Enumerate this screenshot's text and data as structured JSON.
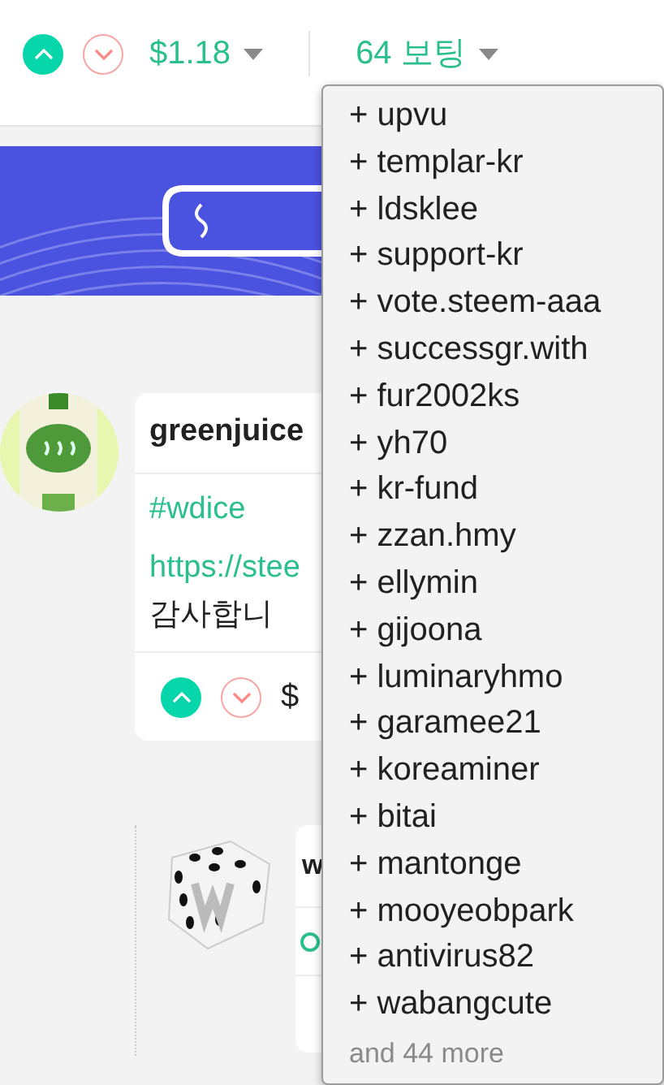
{
  "header": {
    "upvote": {
      "voted": true
    },
    "downvote": {
      "voted": false
    },
    "payout": "$1.18",
    "votes": "64 보팅"
  },
  "voters_dropdown": {
    "voters": [
      "+ upvu",
      "+ templar-kr",
      "+ ldsklee",
      "+ support-kr",
      "+ vote.steem-aaa",
      "+ successgr.with",
      "+ fur2002ks",
      "+ yh70",
      "+ kr-fund",
      "+ zzan.hmy",
      "+ ellymin",
      "+ gijoona",
      "+ luminaryhmo",
      "+ garamee21",
      "+ koreaminer",
      "+ bitai",
      "+ mantonge",
      "+ mooyeobpark",
      "+ antivirus82",
      "+ wabangcute"
    ],
    "more": "and 44 more"
  },
  "posts": [
    {
      "kind": "post",
      "author": "greenjuice",
      "lines": [
        {
          "kind": "tag",
          "text": "#wdice"
        },
        {
          "kind": "link",
          "text": "https://stee"
        },
        {
          "kind": "text",
          "text": "감사합니"
        }
      ],
      "upvote": {
        "voted": true
      },
      "downvote": {
        "voted": false
      },
      "payout": "$"
    },
    {
      "kind": "reply",
      "author": "w"
    }
  ]
}
